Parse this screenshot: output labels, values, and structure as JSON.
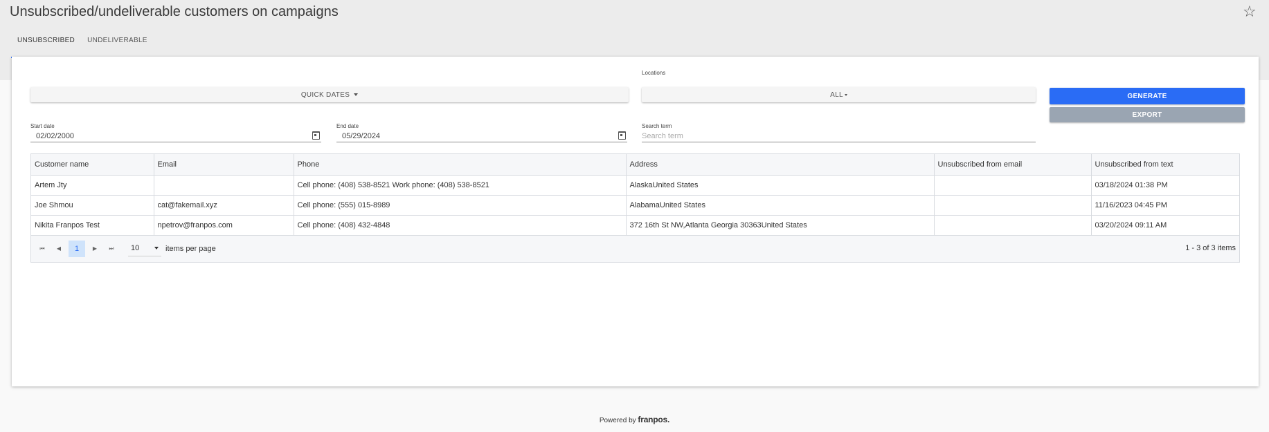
{
  "page": {
    "title": "Unsubscribed/undeliverable customers on campaigns"
  },
  "tabs": [
    {
      "label": "UNSUBSCRIBED",
      "active": true
    },
    {
      "label": "UNDELIVERABLE",
      "active": false
    }
  ],
  "filters": {
    "quick_dates_label": "QUICK DATES",
    "locations_label": "Locations",
    "locations_value": "ALL",
    "start_date_label": "Start date",
    "start_date_value": "02/02/2000",
    "end_date_label": "End date",
    "end_date_value": "05/29/2024",
    "search_label": "Search term",
    "search_placeholder": "Search term",
    "generate_label": "GENERATE",
    "export_label": "EXPORT"
  },
  "table": {
    "columns": [
      "Customer name",
      "Email",
      "Phone",
      "Address",
      "Unsubscribed from email",
      "Unsubscribed from text"
    ],
    "rows": [
      [
        "Artem Jty",
        "",
        "Cell phone: (408) 538-8521 Work phone: (408) 538-8521",
        "AlaskaUnited States",
        "",
        "03/18/2024 01:38 PM"
      ],
      [
        "Joe Shmou",
        "cat@fakemail.xyz",
        "Cell phone: (555) 015-8989",
        "AlabamaUnited States",
        "",
        "11/16/2023 04:45 PM"
      ],
      [
        "Nikita Franpos Test",
        "npetrov@franpos.com",
        "Cell phone: (408) 432-4848",
        "372 16th St NW,Atlanta Georgia 30363United States",
        "",
        "03/20/2024 09:11 AM"
      ]
    ]
  },
  "pager": {
    "current_page": "1",
    "page_size": "10",
    "items_per_page_label": "items per page",
    "count_text": "1 - 3 of 3 items"
  },
  "footer": {
    "powered_by": "Powered by",
    "brand": "franpos."
  },
  "icons": {
    "favorite": "star-outline-icon",
    "calendar": "calendar-icon",
    "first": "pager-first-icon",
    "prev": "pager-prev-icon",
    "next": "pager-next-icon",
    "last": "pager-last-icon"
  },
  "colors": {
    "accent": "#2a6cf5",
    "export_button": "#9aa5b2",
    "page_selected_bg": "#cfe3fb"
  }
}
